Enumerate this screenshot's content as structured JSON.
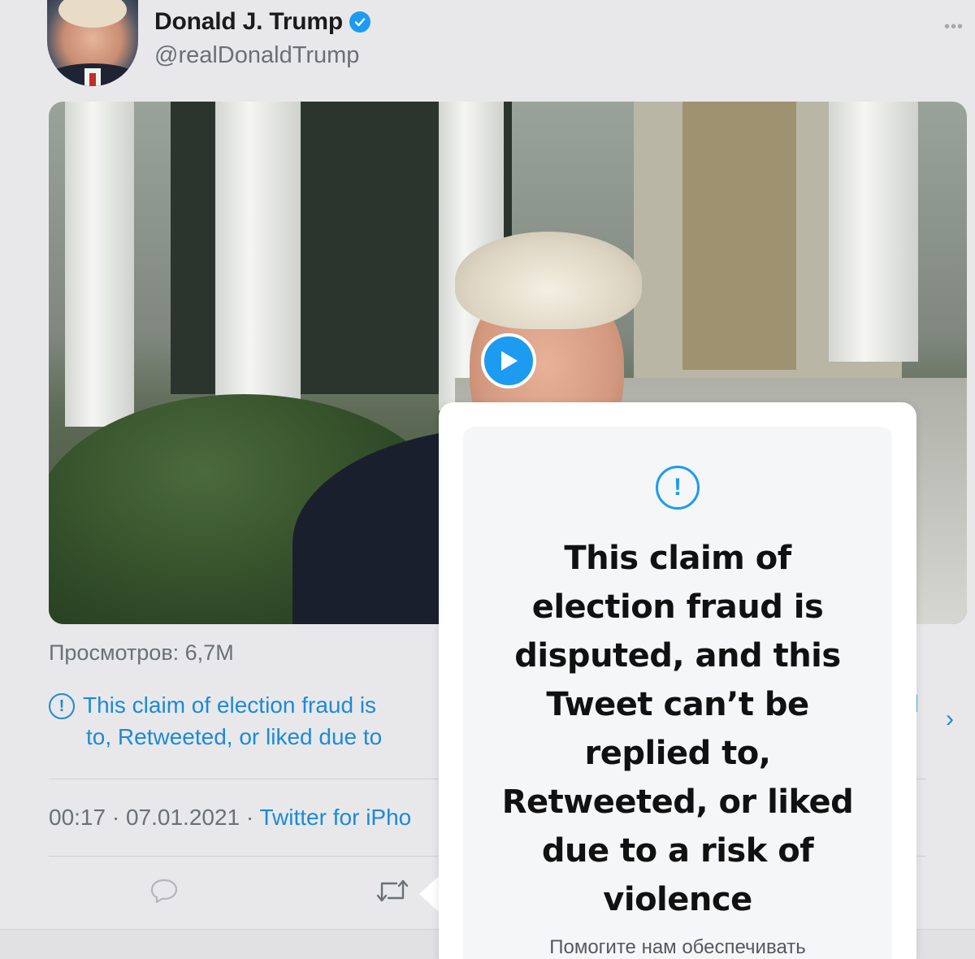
{
  "tweet": {
    "author_name": "Donald J. Trump",
    "handle": "@realDonaldTrump",
    "more_label": "•••",
    "views": "Просмотров: 6,7M",
    "notice_line1": "This claim of election fraud is",
    "notice_line2": "to, Retweeted, or liked due to",
    "notice_cut_fragment": "l",
    "chevron": "›",
    "time": "00:17",
    "date": "07.01.2021",
    "source": "Twitter for iPho",
    "separator": " · "
  },
  "overlay": {
    "title": "This claim of election fraud is disputed, and this Tweet can’t be replied to, Retweeted, or liked due to a risk of violence",
    "title_lines": [
      "This claim of",
      "election fraud is",
      "disputed, and this",
      "Tweet can’t be",
      "replied to,",
      "Retweeted, or liked",
      "due to a risk of",
      "violence"
    ],
    "subtitle": "Помогите нам обеспечивать"
  },
  "icons": {
    "verified": "verified-badge-icon",
    "play": "play-icon",
    "notice": "exclamation-circle-icon",
    "reply": "reply-icon",
    "retweet": "retweet-icon"
  },
  "colors": {
    "accent": "#1d9bf0",
    "link": "#1d8ad6",
    "background": "#e8e8ea",
    "muted_text": "#6b7075"
  }
}
